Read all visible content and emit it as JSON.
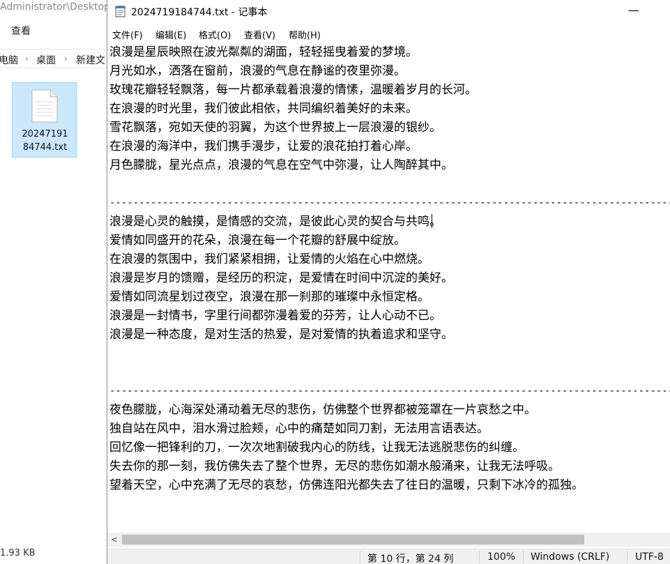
{
  "explorer": {
    "title": "Administrator\\Desktop",
    "ribbon_view": "查看",
    "breadcrumb": [
      "电脑",
      "桌面",
      "新建文"
    ],
    "breadcrumb_sep": "›",
    "file_name_line1": "20247191",
    "file_name_line2": "84744.txt",
    "status_size": "1.93 KB"
  },
  "notepad": {
    "title": "2024719184744.txt - 记事本",
    "minimize_glyph": "—",
    "menu": [
      "文件(F)",
      "编辑(E)",
      "格式(O)",
      "查看(V)",
      "帮助(H)"
    ],
    "lines": [
      "浪漫是星辰映照在波光粼粼的湖面，轻轻摇曳着爱的梦境。",
      "月光如水，洒落在窗前，浪漫的气息在静谧的夜里弥漫。",
      "玫瑰花瓣轻轻飘落，每一片都承载着浪漫的情愫，温暖着岁月的长河。",
      "在浪漫的时光里，我们彼此相依，共同编织着美好的未来。",
      "雪花飘落，宛如天使的羽翼，为这个世界披上一层浪漫的银纱。",
      "在浪漫的海洋中，我们携手漫步，让爱的浪花拍打着心岸。",
      "月色朦胧，星光点点，浪漫的气息在空气中弥漫，让人陶醉其中。",
      "",
      "-----------------------------------------------------------------------------------------------------",
      "浪漫是心灵的触摸，是情感的交流，是彼此心灵的契合与共鸣。",
      "爱情如同盛开的花朵，浪漫在每一个花瓣的舒展中绽放。",
      "在浪漫的氛围中，我们紧紧相拥，让爱情的火焰在心中燃烧。",
      "浪漫是岁月的馈赠，是经历的积淀，是爱情在时间中沉淀的美好。",
      "爱情如同流星划过夜空，浪漫在那一刹那的璀璨中永恒定格。",
      "浪漫是一封情书，字里行间都弥漫着爱的芬芳，让人心动不已。",
      "浪漫是一种态度，是对生活的热爱，是对爱情的执着追求和坚守。",
      "",
      "",
      "-----------------------------------------------------------------------------------------------------",
      "夜色朦胧，心海深处涌动着无尽的悲伤，仿佛整个世界都被笼罩在一片哀愁之中。",
      "独自站在风中，泪水滑过脸颊，心中的痛楚如同刀割，无法用言语表达。",
      "回忆像一把锋利的刀，一次次地割破我内心的防线，让我无法逃脱悲伤的纠缠。",
      "失去你的那一刻，我仿佛失去了整个世界，无尽的悲伤如潮水般涌来，让我无法呼吸。",
      "望着天空，心中充满了无尽的哀愁，仿佛连阳光都失去了往日的温暖，只剩下冰冷的孤独。"
    ],
    "scroll_left_glyph": "<",
    "status": {
      "position": "第 10 行，第 24 列",
      "zoom": "100%",
      "line_ending": "Windows (CRLF)",
      "encoding": "UTF-8"
    }
  }
}
